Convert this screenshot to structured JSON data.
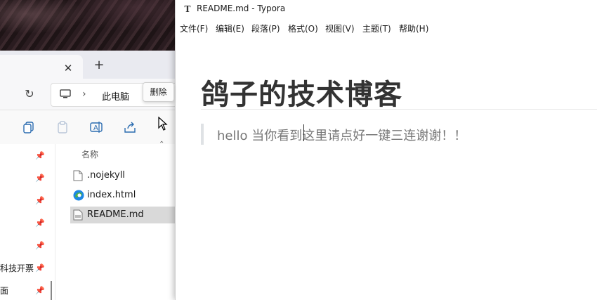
{
  "explorer": {
    "tab_close": "✕",
    "tab_add": "+",
    "refresh_icon": "↻",
    "breadcrumb_sep": "›",
    "breadcrumb_pc": "此电脑",
    "tooltip": "删除",
    "toolbar_icons": [
      "copy-icon",
      "paste-icon",
      "rename-icon",
      "share-icon",
      "delete-icon"
    ],
    "nav_pin": "📌",
    "nav_labels": [
      "科技开票",
      "面"
    ],
    "column_header": "名称",
    "sort_caret": "⌃",
    "files": [
      {
        "name": ".nojekyll",
        "icon": "file-icon",
        "selected": false
      },
      {
        "name": "index.html",
        "icon": "edge-icon",
        "selected": false
      },
      {
        "name": "README.md",
        "icon": "md-file-icon",
        "selected": true
      }
    ]
  },
  "typora": {
    "app_icon": "T",
    "title": "README.md - Typora",
    "menu": [
      "文件(F)",
      "编辑(E)",
      "段落(P)",
      "格式(O)",
      "视图(V)",
      "主题(T)",
      "帮助(H)"
    ],
    "heading": "鸽子的技术博客",
    "quote": "hello 当你看到这里请点好一键三连谢谢！！"
  },
  "colors": {
    "accent_selected": "#d9d9d9",
    "heading": "#333333",
    "quote_text": "#777777",
    "quote_border": "#dfe2e5"
  }
}
